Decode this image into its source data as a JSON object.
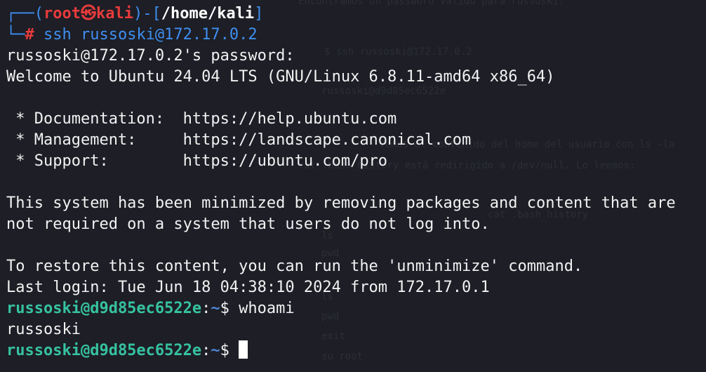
{
  "background_text": [
    "Encontramos un password válido para russoski:",
    "$ ssh russoski@172.17.0.2",
    "russoski@d9d85ec6522e",
    "Vemos el contenido del home del usuario con ls -la",
    "cat .bash_history está redirigido a /dev/null. Lo leemos:",
    "cat .bash_history",
    "ls",
    "pwd",
    "ls",
    "pwd",
    "exit",
    "su root"
  ],
  "prompt": {
    "open": "┌──(",
    "user": "root",
    "symbol": "㉿",
    "host": "kali",
    "mid": ")-[",
    "path": "/home/kali",
    "close": "]",
    "second_prefix": "└─",
    "hash": "#",
    "command": " ssh russoski@172.17.0.2"
  },
  "output": {
    "password": "russoski@172.17.0.2's password:",
    "welcome": "Welcome to Ubuntu 24.04 LTS (GNU/Linux 6.8.11-amd64 x86_64)",
    "doc": " * Documentation:  https://help.ubuntu.com",
    "mgmt": " * Management:     https://landscape.canonical.com",
    "support": " * Support:        https://ubuntu.com/pro",
    "min1": "This system has been minimized by removing packages and content that are",
    "min2": "not required on a system that users do not log into.",
    "restore": "To restore this content, you can run the 'unminimize' command.",
    "lastlogin": "Last login: Tue Jun 18 04:38:10 2024 from 172.17.0.1"
  },
  "remote_prompt": {
    "user_host": "russoski@d9d85ec6522e",
    "colon": ":",
    "tilde": "~",
    "dollar": "$ ",
    "cmd1": "whoami",
    "result1": "russoski"
  }
}
